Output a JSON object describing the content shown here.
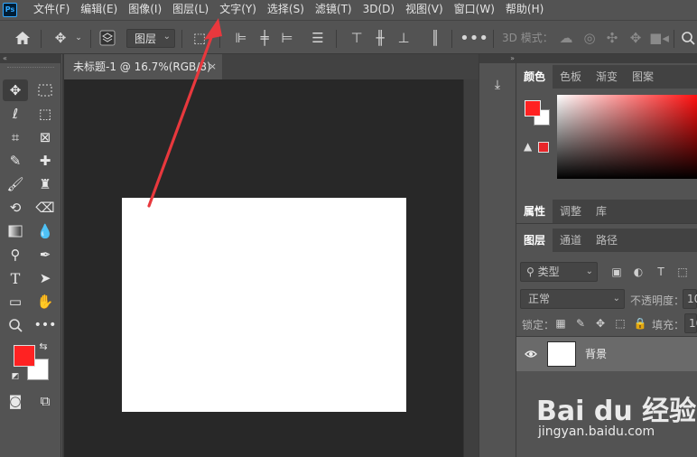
{
  "app": {
    "logo_text": "Ps"
  },
  "menu": [
    "文件(F)",
    "编辑(E)",
    "图像(I)",
    "图层(L)",
    "文字(Y)",
    "选择(S)",
    "滤镜(T)",
    "3D(D)",
    "视图(V)",
    "窗口(W)",
    "帮助(H)"
  ],
  "options_bar": {
    "auto_select_value": "图层",
    "three_d_mode_label": "3D 模式："
  },
  "document": {
    "tab_title": "未标题-1 @ 16.7%(RGB/8)",
    "tab_close": "×"
  },
  "colors": {
    "foreground": "#ff2222",
    "background": "#ffffff",
    "canvas": "#ffffff",
    "annotation_arrow": "#e8383d"
  },
  "panels": {
    "top_tabs": [
      "颜色",
      "色板",
      "渐变",
      "图案"
    ],
    "mid_tabs": [
      "属性",
      "调整",
      "库"
    ],
    "layer_tabs": [
      "图层",
      "通道",
      "路径"
    ]
  },
  "layers_panel": {
    "filter_kind": "类型",
    "blend_mode": "正常",
    "opacity_label": "不透明度：",
    "opacity_value": "10",
    "lock_label": "锁定：",
    "fill_label": "填充：",
    "fill_value": "10",
    "layers": [
      {
        "name": "背景",
        "visible": true
      }
    ]
  },
  "watermark": {
    "brand": "Bai du 经验",
    "url": "jingyan.baidu.com"
  }
}
